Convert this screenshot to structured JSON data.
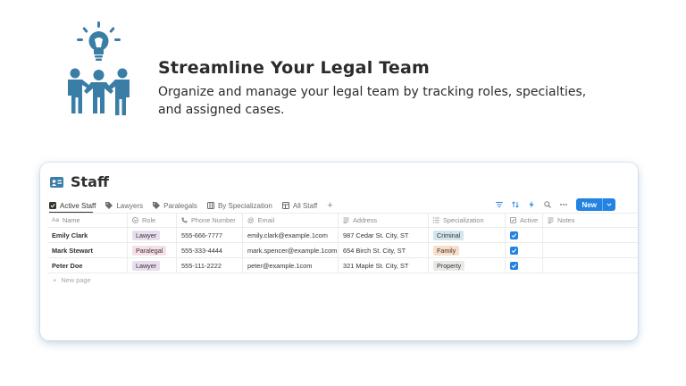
{
  "hero": {
    "title": "Streamline Your Legal Team",
    "subtitle": "Organize and manage your legal team by tracking roles, specialties, and assigned cases.",
    "icon": "team-idea-icon"
  },
  "database": {
    "title": "Staff",
    "icon": "id-card-icon",
    "tabs": [
      {
        "label": "Active Staff",
        "icon": "checkbox-icon"
      },
      {
        "label": "Lawyers",
        "icon": "tag-icon"
      },
      {
        "label": "Paralegals",
        "icon": "tag-icon"
      },
      {
        "label": "By Specialization",
        "icon": "board-icon"
      },
      {
        "label": "All Staff",
        "icon": "table-icon"
      }
    ],
    "add_view": "+",
    "new_button": "New",
    "columns": [
      "Name",
      "Role",
      "Phone Number",
      "Email",
      "Address",
      "Specialization",
      "Active",
      "Notes"
    ],
    "column_icon_aa": "Aa",
    "rows": [
      {
        "name": "Emily Clark",
        "role": "Lawyer",
        "phone": "555-666-7777",
        "email": "emily.clark@example.1com",
        "address": "987 Cedar St. City, ST",
        "specialization": "Criminal",
        "active": true,
        "notes": ""
      },
      {
        "name": "Mark Stewart",
        "role": "Paralegal",
        "phone": "555-333-4444",
        "email": "mark.spencer@example.1com",
        "address": "654 Birch St. City, ST",
        "specialization": "Family",
        "active": true,
        "notes": ""
      },
      {
        "name": "Peter Doe",
        "role": "Lawyer",
        "phone": "555-111-2222",
        "email": "peter@example.1com",
        "address": "321 Maple St. City, ST",
        "specialization": "Property",
        "active": true,
        "notes": ""
      }
    ],
    "new_page": "New page",
    "new_page_plus": "+"
  },
  "colors": {
    "accent": "#2383e2",
    "hero_icon": "#3a7ea6",
    "role_lawyer": "#e8deee",
    "role_paralegal": "#f5e0e9",
    "spec_criminal": "#d3e5ef",
    "spec_family": "#fadec9",
    "spec_property": "#e9e9e7"
  }
}
